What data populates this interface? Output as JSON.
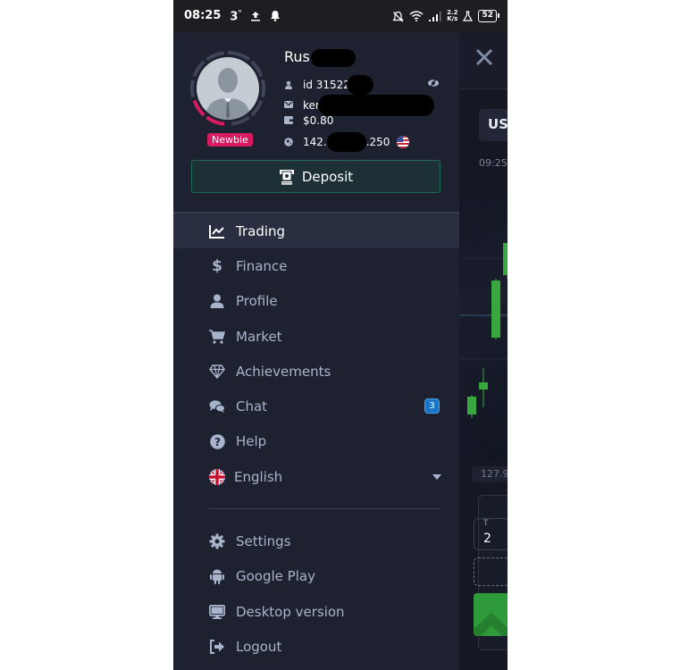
{
  "status_bar": {
    "time": "08:25",
    "temperature": "3",
    "temperature_unit": "°",
    "speed_value": "2.2",
    "speed_unit": "K/s",
    "battery": "52",
    "icons": [
      "upload-icon",
      "bell-icon",
      "bell-off-icon",
      "wifi-icon",
      "signal-icon",
      "flask-icon",
      "battery-icon"
    ]
  },
  "profile": {
    "name": "Rus.",
    "id": "id 31522",
    "email": "ker",
    "balance": "$0.80",
    "ip_prefix": "142.",
    "ip_suffix": ".250",
    "country_flag": "US",
    "level_badge": "Newbie",
    "ring_accent_color": "#d81b60",
    "ring_base_color": "#3f4459"
  },
  "deposit": {
    "label": "Deposit",
    "border_color": "#1f6b55"
  },
  "nav": {
    "items": [
      {
        "id": "trading",
        "label": "Trading",
        "icon": "chart-line-icon",
        "active": true
      },
      {
        "id": "finance",
        "label": "Finance",
        "icon": "dollar-icon"
      },
      {
        "id": "profile",
        "label": "Profile",
        "icon": "user-icon"
      },
      {
        "id": "market",
        "label": "Market",
        "icon": "cart-icon"
      },
      {
        "id": "achievements",
        "label": "Achievements",
        "icon": "diamond-icon"
      },
      {
        "id": "chat",
        "label": "Chat",
        "icon": "chat-icon",
        "badge": "3"
      },
      {
        "id": "help",
        "label": "Help",
        "icon": "question-icon"
      }
    ],
    "language": {
      "label": "English",
      "icon": "uk-flag-icon"
    },
    "secondary": [
      {
        "id": "settings",
        "label": "Settings",
        "icon": "gear-icon"
      },
      {
        "id": "google-play",
        "label": "Google Play",
        "icon": "android-icon"
      },
      {
        "id": "desktop",
        "label": "Desktop version",
        "icon": "desktop-icon"
      },
      {
        "id": "logout",
        "label": "Logout",
        "icon": "logout-icon"
      }
    ]
  },
  "background_app": {
    "pair_label": "US",
    "time_label": "09:25",
    "price_label": "127.9",
    "input_label": "T",
    "input_value": "2",
    "up_color": "#2e9a3a"
  }
}
